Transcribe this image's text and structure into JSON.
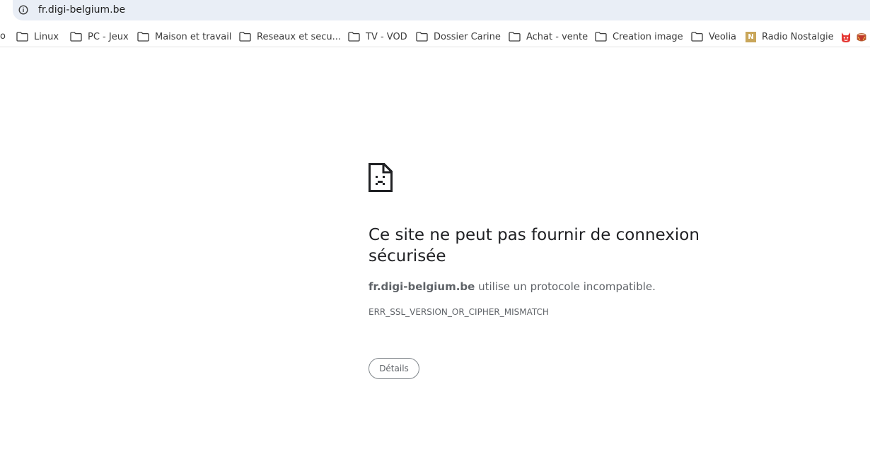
{
  "address_bar": {
    "url": "fr.digi-belgium.be"
  },
  "bookmarks": {
    "partial_label": "o",
    "items": [
      {
        "label": "Linux",
        "icon": "folder-icon"
      },
      {
        "label": "PC - Jeux",
        "icon": "folder-icon"
      },
      {
        "label": "Maison et travail",
        "icon": "folder-icon"
      },
      {
        "label": "Reseaux et secu...",
        "icon": "folder-icon"
      },
      {
        "label": "TV - VOD",
        "icon": "folder-icon"
      },
      {
        "label": "Dossier Carine",
        "icon": "folder-icon"
      },
      {
        "label": "Achat - vente",
        "icon": "folder-icon"
      },
      {
        "label": "Creation image",
        "icon": "folder-icon"
      },
      {
        "label": "Veolia",
        "icon": "folder-icon"
      },
      {
        "label": "Radio Nostalgie",
        "icon": "nostalgie-favicon",
        "favicon_letter": "N"
      }
    ]
  },
  "error": {
    "title": "Ce site ne peut pas fournir de connexion sécurisée",
    "host": "fr.digi-belgium.be",
    "message": " utilise un protocole incompatible.",
    "code": "ERR_SSL_VERSION_OR_CIPHER_MISMATCH",
    "details_label": "Détails"
  },
  "colors": {
    "omnibox_bg": "#e9eef6",
    "title_text": "#202124",
    "secondary_text": "#5f6368",
    "nostalgie_brand": "#c9a65a"
  }
}
